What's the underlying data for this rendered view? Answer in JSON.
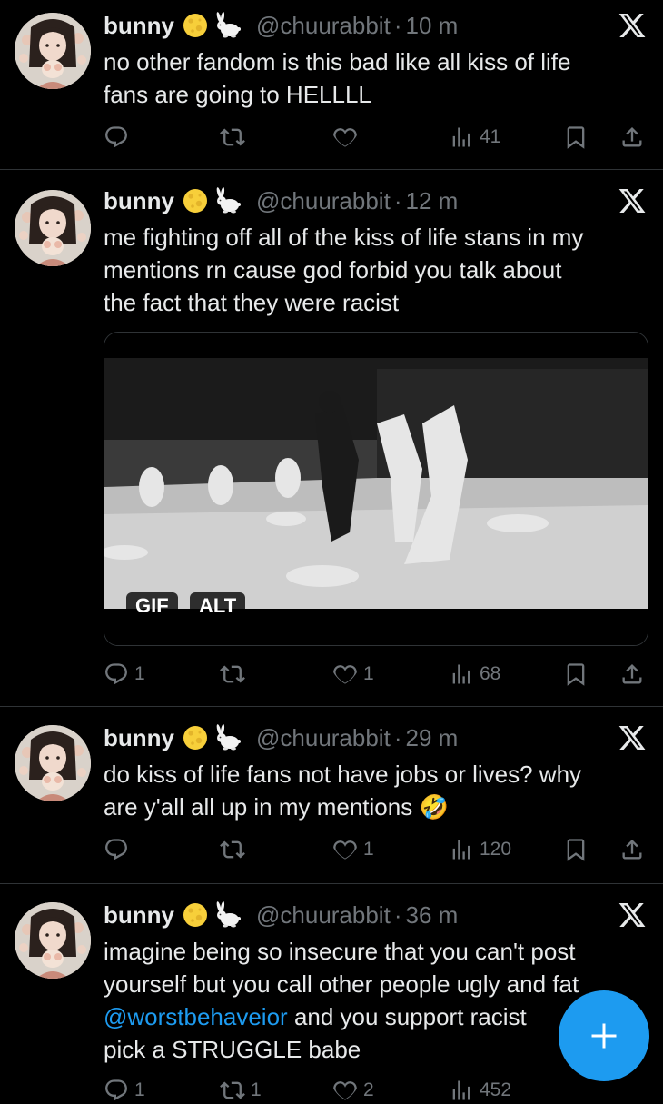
{
  "tweets": [
    {
      "name": "bunny",
      "handle": "@chuurabbit",
      "sep": "·",
      "time": "10 m",
      "text": "no other fandom is this bad like all kiss of life\nfans are going to HELLLL",
      "replies": "",
      "retweets": "",
      "likes": "",
      "views": "41"
    },
    {
      "name": "bunny",
      "handle": "@chuurabbit",
      "sep": "·",
      "time": "12 m",
      "text": "me fighting off all of the kiss of life stans in my\nmentions rn cause god forbid you talk about\nthe fact that they were racist",
      "media_badges": [
        "GIF",
        "ALT"
      ],
      "replies": "1",
      "retweets": "",
      "likes": "1",
      "views": "68"
    },
    {
      "name": "bunny",
      "handle": "@chuurabbit",
      "sep": "·",
      "time": "29 m",
      "text": "do kiss of life fans not have jobs or lives? why\nare y'all all up in my mentions 🤣",
      "replies": "",
      "retweets": "",
      "likes": "1",
      "views": "120"
    },
    {
      "name": "bunny",
      "handle": "@chuurabbit",
      "sep": "·",
      "time": "36 m",
      "text_before_mention": "imagine being so insecure that you can't post\nyourself but you call other people ugly and fat\n",
      "mention": "@worstbehaveior",
      "text_after_mention": " and you support racist\npick a STRUGGLE babe",
      "replies": "1",
      "retweets": "1",
      "likes": "2",
      "views": "452"
    }
  ],
  "icons": {
    "reply": "reply-icon",
    "retweet": "retweet-icon",
    "like": "heart-icon",
    "views": "views-icon",
    "bookmark": "bookmark-icon",
    "share": "share-icon",
    "x_logo": "x-logo-icon",
    "compose": "compose-plus-icon"
  },
  "colors": {
    "background": "#000000",
    "text": "#e7e9ea",
    "muted": "#71767b",
    "accent": "#1d9bf0",
    "divider": "#2f3336"
  }
}
